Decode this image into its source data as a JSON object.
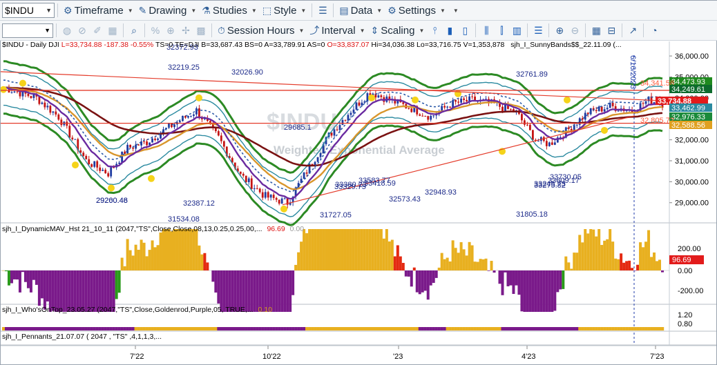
{
  "toolbar": {
    "symbol": "$INDU",
    "timeframe": "Timeframe",
    "drawing": "Drawing",
    "studies": "Studies",
    "style": "Style",
    "data": "Data",
    "settings": "Settings",
    "session_hours": "Session Hours",
    "interval": "Interval",
    "scaling": "Scaling"
  },
  "header": {
    "symbol_line": "$INDU - Daily  DJI",
    "last": "L=33,734.88",
    "change": "-187.38",
    "change_pct": "-0.55%",
    "rest": "TS=0  TE=DJI  B=33,687.43  BS=0  A=33,789.91  AS=0",
    "open": "O=33,837.07",
    "stats": "Hi=34,036.38  Lo=33,716.75  V=1,353,878",
    "indicator": "sjh_I_SunnyBands$$_22.11.09 (..."
  },
  "panes": {
    "dmav": {
      "title": "sjh_I_DynamicMAV_Hst 21_10_11 (2047,\"TS\",Close,Close,08,13,0.25,0.25,00,...",
      "v1": "96.69",
      "v2": "0.00"
    },
    "wot": {
      "title": "sjh_I_Who'sOnTop_23.05.27 (2047,\"TS\",Close,Goldenrod,Purple,05,  TRUE,...",
      "v1": "0.10"
    },
    "pennants": {
      "title": "sjh_I_Pennants_21.07.07 ( 2047 , \"TS\" ,4,1,1,3,..."
    }
  },
  "price_axis": [
    "36,000.00",
    "35,000.00",
    "34,000.00",
    "33,000.00",
    "32,000.00",
    "31,000.00",
    "30,000.00",
    "29,000.00"
  ],
  "price_badges": [
    {
      "text": "34,473.93",
      "color": "#1f8a1f"
    },
    {
      "text": "34,341.58",
      "color": "#ff5a3c"
    },
    {
      "text": "34,249.61",
      "color": "#0d6b2d"
    },
    {
      "text": "33,734.88",
      "color": "#e21b1b"
    },
    {
      "text": "33,462.99",
      "color": "#2b8aa0"
    },
    {
      "text": "32,976.33",
      "color": "#1a8a3a"
    },
    {
      "text": "32,805.72",
      "color": "#ff5a3c"
    },
    {
      "text": "32,588.56",
      "color": "#e0a020"
    }
  ],
  "dmav_axis": [
    "200.00",
    "0.00",
    "-200.00"
  ],
  "dmav_badge": "96.69",
  "wot_axis": [
    "1.20",
    "0.80"
  ],
  "date_axis": [
    "7'22",
    "10'22",
    "'23",
    "4'23",
    "7'23"
  ],
  "vertical_date": "6/16/2023",
  "chart_labels": [
    "32219.25",
    "32026.90",
    "32372.93",
    "32761.89",
    "29685.1",
    "32387.12",
    "31534.08",
    "31727.05",
    "33583.77",
    "33380.23",
    "33418.59",
    "33329.75",
    "32573.43",
    "32948.93",
    "33730.05",
    "33609.17",
    "33275.82",
    "33245.73",
    "31805.18",
    "29260.46",
    "29200.48"
  ],
  "watermark_sub": "Weighted Exponential Average"
}
